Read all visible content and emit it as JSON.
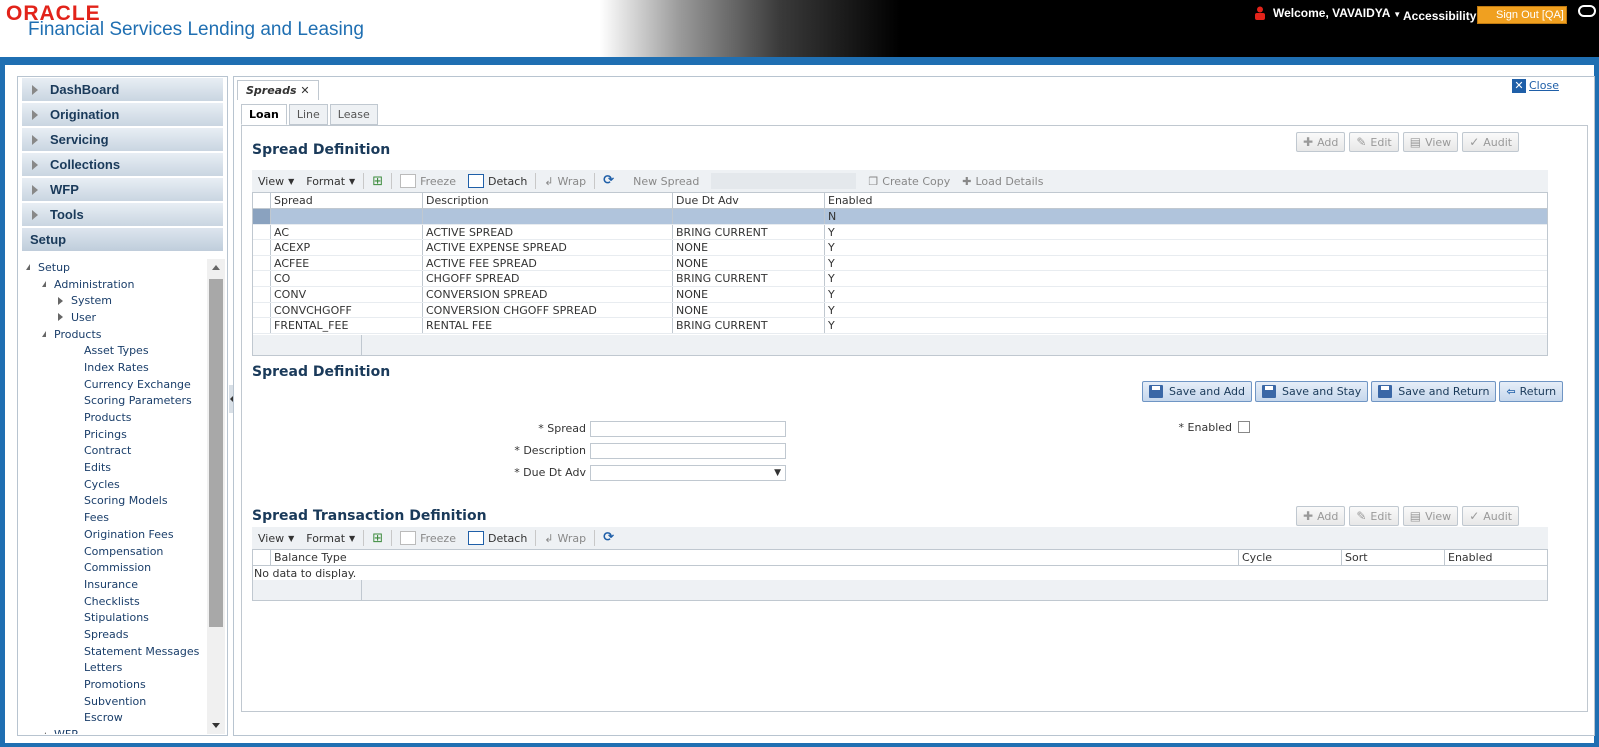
{
  "header": {
    "brand": "ORACLE",
    "product": "Financial Services Lending and Leasing",
    "welcome": "Welcome, VAVAIDYA",
    "accessibility": "Accessibility",
    "signout": "Sign Out [QA]"
  },
  "sidebar": {
    "sections": [
      "DashBoard",
      "Origination",
      "Servicing",
      "Collections",
      "WFP",
      "Tools"
    ],
    "active_section": "Setup",
    "tree": [
      {
        "label": "Setup",
        "level": 0,
        "state": "open"
      },
      {
        "label": "Administration",
        "level": 1,
        "state": "open"
      },
      {
        "label": "System",
        "level": 2,
        "state": "closed"
      },
      {
        "label": "User",
        "level": 2,
        "state": "closed"
      },
      {
        "label": "Products",
        "level": 1,
        "state": "open"
      },
      {
        "label": "Asset Types",
        "level": 3,
        "state": "leaf"
      },
      {
        "label": "Index Rates",
        "level": 3,
        "state": "leaf"
      },
      {
        "label": "Currency Exchange",
        "level": 3,
        "state": "leaf"
      },
      {
        "label": "Scoring Parameters",
        "level": 3,
        "state": "leaf"
      },
      {
        "label": "Products",
        "level": 3,
        "state": "leaf"
      },
      {
        "label": "Pricings",
        "level": 3,
        "state": "leaf"
      },
      {
        "label": "Contract",
        "level": 3,
        "state": "leaf"
      },
      {
        "label": "Edits",
        "level": 3,
        "state": "leaf"
      },
      {
        "label": "Cycles",
        "level": 3,
        "state": "leaf"
      },
      {
        "label": "Scoring Models",
        "level": 3,
        "state": "leaf"
      },
      {
        "label": "Fees",
        "level": 3,
        "state": "leaf"
      },
      {
        "label": "Origination Fees",
        "level": 3,
        "state": "leaf"
      },
      {
        "label": "Compensation",
        "level": 3,
        "state": "leaf"
      },
      {
        "label": "Commission",
        "level": 3,
        "state": "leaf"
      },
      {
        "label": "Insurance",
        "level": 3,
        "state": "leaf"
      },
      {
        "label": "Checklists",
        "level": 3,
        "state": "leaf"
      },
      {
        "label": "Stipulations",
        "level": 3,
        "state": "leaf"
      },
      {
        "label": "Spreads",
        "level": 3,
        "state": "leaf"
      },
      {
        "label": "Statement Messages",
        "level": 3,
        "state": "leaf"
      },
      {
        "label": "Letters",
        "level": 3,
        "state": "leaf"
      },
      {
        "label": "Promotions",
        "level": 3,
        "state": "leaf"
      },
      {
        "label": "Subvention",
        "level": 3,
        "state": "leaf"
      },
      {
        "label": "Escrow",
        "level": 3,
        "state": "leaf"
      },
      {
        "label": "WFP",
        "level": 1,
        "state": "open"
      }
    ]
  },
  "main": {
    "doc_tab": "Spreads",
    "close": "Close",
    "tabs": [
      "Loan",
      "Line",
      "Lease"
    ],
    "spread_def": {
      "title": "Spread Definition",
      "actions": [
        "Add",
        "Edit",
        "View",
        "Audit"
      ],
      "toolbar": {
        "view": "View",
        "format": "Format",
        "freeze": "Freeze",
        "detach": "Detach",
        "wrap": "Wrap",
        "new_spread": "New Spread",
        "create_copy": "Create Copy",
        "load_details": "Load Details"
      },
      "columns": [
        "Spread",
        "Description",
        "Due Dt Adv",
        "Enabled"
      ],
      "rows": [
        [
          "",
          "",
          "",
          "N"
        ],
        [
          "AC",
          "ACTIVE SPREAD",
          "BRING CURRENT",
          "Y"
        ],
        [
          "ACEXP",
          "ACTIVE EXPENSE SPREAD",
          "NONE",
          "Y"
        ],
        [
          "ACFEE",
          "ACTIVE FEE SPREAD",
          "NONE",
          "Y"
        ],
        [
          "CO",
          "CHGOFF SPREAD",
          "BRING CURRENT",
          "Y"
        ],
        [
          "CONV",
          "CONVERSION SPREAD",
          "NONE",
          "Y"
        ],
        [
          "CONVCHGOFF",
          "CONVERSION CHGOFF SPREAD",
          "NONE",
          "Y"
        ],
        [
          "FRENTAL_FEE",
          "RENTAL FEE",
          "BRING CURRENT",
          "Y"
        ]
      ]
    },
    "form": {
      "title": "Spread Definition",
      "buttons": [
        "Save and Add",
        "Save and Stay",
        "Save and Return",
        "Return"
      ],
      "spread_label": "* Spread",
      "description_label": "* Description",
      "due_label": "* Due Dt Adv",
      "enabled_label": "* Enabled"
    },
    "txn_def": {
      "title": "Spread Transaction Definition",
      "actions": [
        "Add",
        "Edit",
        "View",
        "Audit"
      ],
      "toolbar": {
        "view": "View",
        "format": "Format",
        "freeze": "Freeze",
        "detach": "Detach",
        "wrap": "Wrap"
      },
      "columns": [
        "Balance Type",
        "Cycle",
        "Sort",
        "Enabled"
      ],
      "empty": "No data to display."
    }
  }
}
